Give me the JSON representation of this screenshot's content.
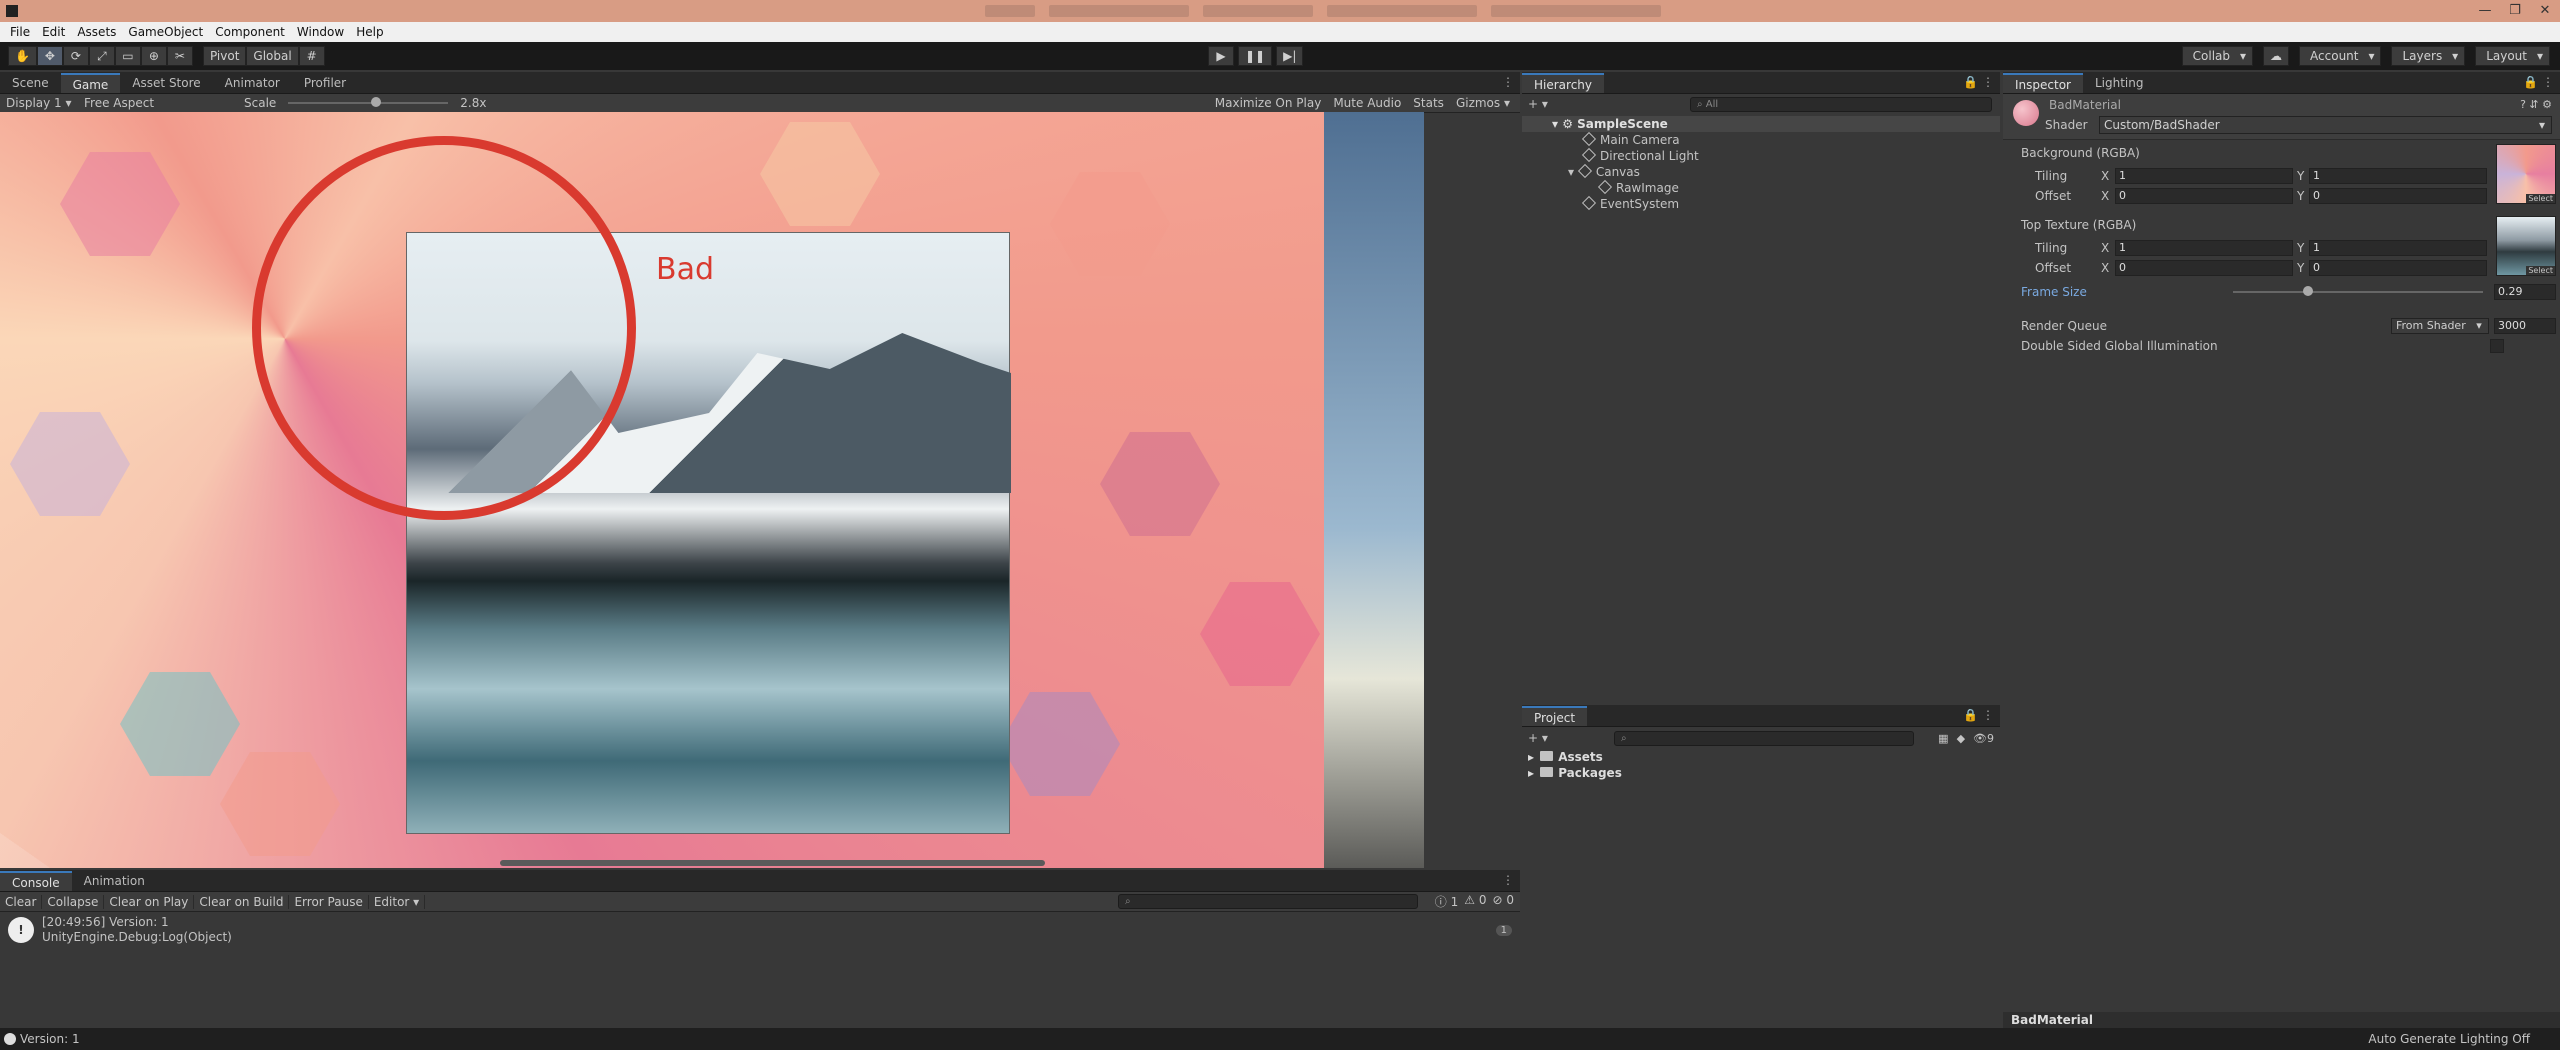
{
  "title_bar": {
    "min": "—",
    "max": "❐",
    "close": "✕"
  },
  "menu": [
    "File",
    "Edit",
    "Assets",
    "GameObject",
    "Component",
    "Window",
    "Help"
  ],
  "toolbar": {
    "tools": [
      "✋",
      "✥",
      "⟳",
      "⤢",
      "▭",
      "⊕",
      "✂"
    ],
    "pivot": "Pivot",
    "global": "Global",
    "grid": "#",
    "collab": "Collab",
    "cloud": "☁",
    "account": "Account",
    "layers": "Layers",
    "layout": "Layout"
  },
  "game_panel": {
    "tabs": [
      "Scene",
      "Game",
      "Asset Store",
      "Animator",
      "Profiler"
    ],
    "display": "Display 1",
    "aspect": "Free Aspect",
    "scale_label": "Scale",
    "scale_value": "2.8x",
    "scale_level": 0.55,
    "maximize": "Maximize On Play",
    "mute": "Mute Audio",
    "stats": "Stats",
    "gizmos": "Gizmos",
    "annotation": "Bad"
  },
  "console": {
    "tabs": [
      "Console",
      "Animation"
    ],
    "buttons": [
      "Clear",
      "Collapse",
      "Clear on Play",
      "Clear on Build",
      "Error Pause",
      "Editor"
    ],
    "counts": {
      "info": "1",
      "warn": "0",
      "error": "0"
    },
    "log_line1": "[20:49:56] Version: 1",
    "log_line2": "UnityEngine.Debug:Log(Object)",
    "log_count": "1"
  },
  "hierarchy": {
    "tab": "Hierarchy",
    "search_placeholder": "All",
    "items": [
      "SampleScene",
      "Main Camera",
      "Directional Light",
      "Canvas",
      "RawImage",
      "EventSystem"
    ]
  },
  "project": {
    "tab": "Project",
    "items": [
      "Assets",
      "Packages"
    ],
    "hidden_count": "9"
  },
  "inspector": {
    "tabs": [
      "Inspector",
      "Lighting"
    ],
    "material_name": "BadMaterial",
    "shader_label": "Shader",
    "shader_value": "Custom/BadShader",
    "background_label": "Background (RGBA)",
    "top_texture_label": "Top Texture (RGBA)",
    "tiling": "Tiling",
    "offset": "Offset",
    "x": "X",
    "y": "Y",
    "bg_tiling": [
      "1",
      "1"
    ],
    "bg_offset": [
      "0",
      "0"
    ],
    "top_tiling": [
      "1",
      "1"
    ],
    "top_offset": [
      "0",
      "0"
    ],
    "select": "Select",
    "frame_size_label": "Frame Size",
    "frame_size_value": "0.29",
    "frame_size_level": 0.29,
    "render_queue_label": "Render Queue",
    "render_queue_mode": "From Shader",
    "render_queue_value": "3000",
    "double_sided_label": "Double Sided Global Illumination",
    "footer": "BadMaterial"
  },
  "status": {
    "left": "Version: 1",
    "right": "Auto Generate Lighting Off"
  }
}
